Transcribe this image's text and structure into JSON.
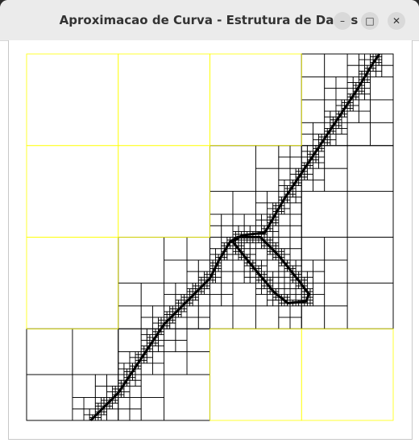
{
  "window": {
    "title": "Aproximacao de Curva - Estrutura de Dados",
    "minimize_icon": "minimize-icon",
    "maximize_icon": "maximize-icon",
    "close_icon": "close-icon"
  },
  "quadtree": {
    "root_extent": [
      0,
      4
    ],
    "split_color": "#ffff00",
    "cell_color": "#000000",
    "curve_color": "#000000"
  }
}
